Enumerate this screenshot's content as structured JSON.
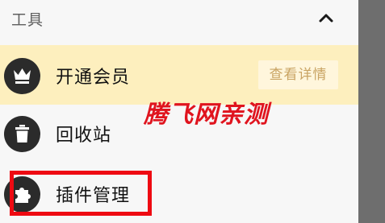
{
  "section": {
    "title": "工具",
    "collapse_icon": "chevron-up-icon"
  },
  "rows": [
    {
      "label": "开通会员",
      "icon": "crown-icon",
      "action_label": "查看详情"
    },
    {
      "label": "回收站",
      "icon": "trash-icon"
    },
    {
      "label": "插件管理",
      "icon": "puzzle-icon"
    }
  ],
  "watermark": "腾飞网亲测",
  "colors": {
    "vip_row_bg": "#fdefbe",
    "detail_text": "#c9a463",
    "watermark": "#e0141e",
    "highlight_border": "#ee0a12",
    "icon_circle": "#2b2b2b"
  }
}
